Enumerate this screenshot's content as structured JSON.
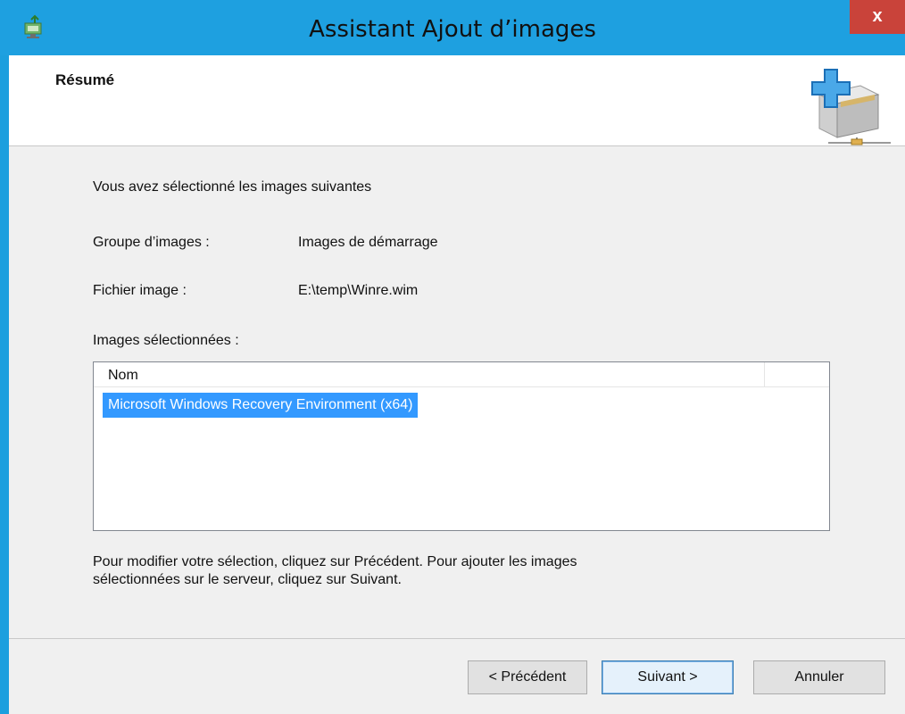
{
  "window": {
    "title": "Assistant Ajout d’images",
    "close_label": "x"
  },
  "header": {
    "heading": "Résumé"
  },
  "content": {
    "intro": "Vous avez sélectionné les images suivantes",
    "fields": [
      {
        "label": "Groupe d’images :",
        "value": "Images de démarrage"
      },
      {
        "label": "Fichier image :",
        "value": "E:\\temp\\Winre.wim"
      }
    ],
    "list_label": "Images sélectionnées :",
    "list": {
      "columns": [
        "Nom"
      ],
      "rows": [
        "Microsoft Windows Recovery Environment (x64)"
      ]
    },
    "help_line1": "Pour modifier votre sélection, cliquez sur Précédent. Pour ajouter les images",
    "help_line2": "sélectionnées sur le serveur, cliquez sur Suivant."
  },
  "buttons": {
    "back": "< Précédent",
    "next": "Suivant >",
    "cancel": "Annuler"
  },
  "colors": {
    "titlebar": "#1ea0e0",
    "close": "#c9433a",
    "selection": "#3399ff"
  },
  "icons": [
    "wds-app-icon",
    "add-image-wizard-icon"
  ]
}
